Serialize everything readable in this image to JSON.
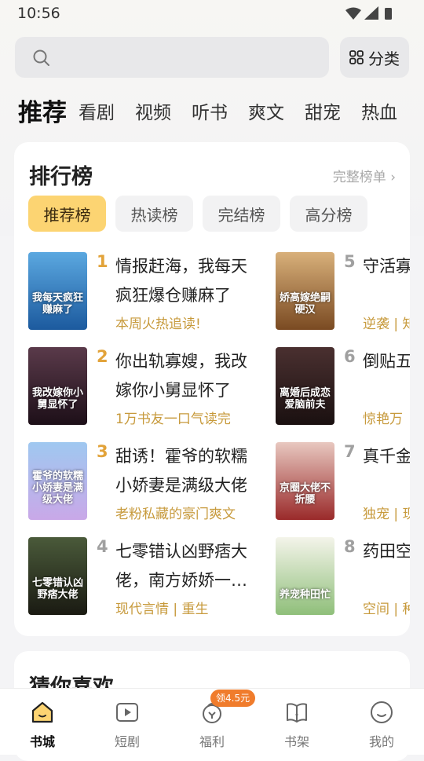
{
  "status": {
    "time": "10:56"
  },
  "search": {
    "placeholder": ""
  },
  "category_button": {
    "label": "分类"
  },
  "tabs": [
    "推荐",
    "看剧",
    "视频",
    "听书",
    "爽文",
    "甜宠",
    "热血"
  ],
  "ranking": {
    "title": "排行榜",
    "more": "完整榜单",
    "pills": [
      "推荐榜",
      "热读榜",
      "完结榜",
      "高分榜"
    ],
    "books": [
      {
        "rank": "1",
        "title": "情报赶海，我每天疯狂爆仓赚麻了",
        "tag": "本周火热追读!",
        "cover_text": "我每天疯狂赚麻了",
        "color_top": "#5ba8e0",
        "color_bottom": "#1c5a9e",
        "rank_color": "#e2a33a"
      },
      {
        "rank": "2",
        "title": "你出轨寡嫂，我改嫁你小舅显怀了",
        "tag": "1万书友一口气读完",
        "cover_text": "我改嫁你小舅显怀了",
        "color_top": "#5a3a4a",
        "color_bottom": "#1d0f18",
        "rank_color": "#e2a33a"
      },
      {
        "rank": "3",
        "title": "甜诱！霍爷的软糯小娇妻是满级大佬",
        "tag": "老粉私藏的豪门爽文",
        "cover_text": "霍爷的软糯小娇妻是满级大佬",
        "color_top": "#9fc8f0",
        "color_bottom": "#c9a8e8",
        "rank_color": "#e2a33a"
      },
      {
        "rank": "4",
        "title": "七零错认凶野痞大佬，南方娇娇一…",
        "tag": "现代言情 | 重生",
        "cover_text": "七零错认凶野痞大佬",
        "color_top": "#4a5a3a",
        "color_bottom": "#1a1a12",
        "rank_color": "#a0a0a0"
      },
      {
        "rank": "5",
        "title": "守活寡绝嗣首",
        "tag": "逆袭 | 知",
        "cover_text": "娇高嫁绝嗣硬汉",
        "color_top": "#d8b07a",
        "color_bottom": "#7a4a22",
        "rank_color": "#a0a0a0"
      },
      {
        "rank": "6",
        "title": "倒贴五前夫成",
        "tag": "惊艳万",
        "cover_text": "离婚后成恋爱脑前夫",
        "color_top": "#4a3030",
        "color_bottom": "#1a1010",
        "rank_color": "#a0a0a0"
      },
      {
        "rank": "7",
        "title": "真千金京圈大",
        "tag": "独宠 | 现",
        "cover_text": "京圈大佬不折腰",
        "color_top": "#e8c8c0",
        "color_bottom": "#9a2a2a",
        "rank_color": "#a0a0a0"
      },
      {
        "rank": "8",
        "title": "药田空我种田",
        "tag": "空间 | 种",
        "cover_text": "养宠种田忙",
        "color_top": "#f4f4ea",
        "color_bottom": "#8fbf7a",
        "rank_color": "#a0a0a0"
      }
    ]
  },
  "guess": {
    "title": "猜你喜欢"
  },
  "nav": {
    "items": [
      "书城",
      "短剧",
      "福利",
      "书架",
      "我的"
    ],
    "badge": "领4.5元"
  }
}
